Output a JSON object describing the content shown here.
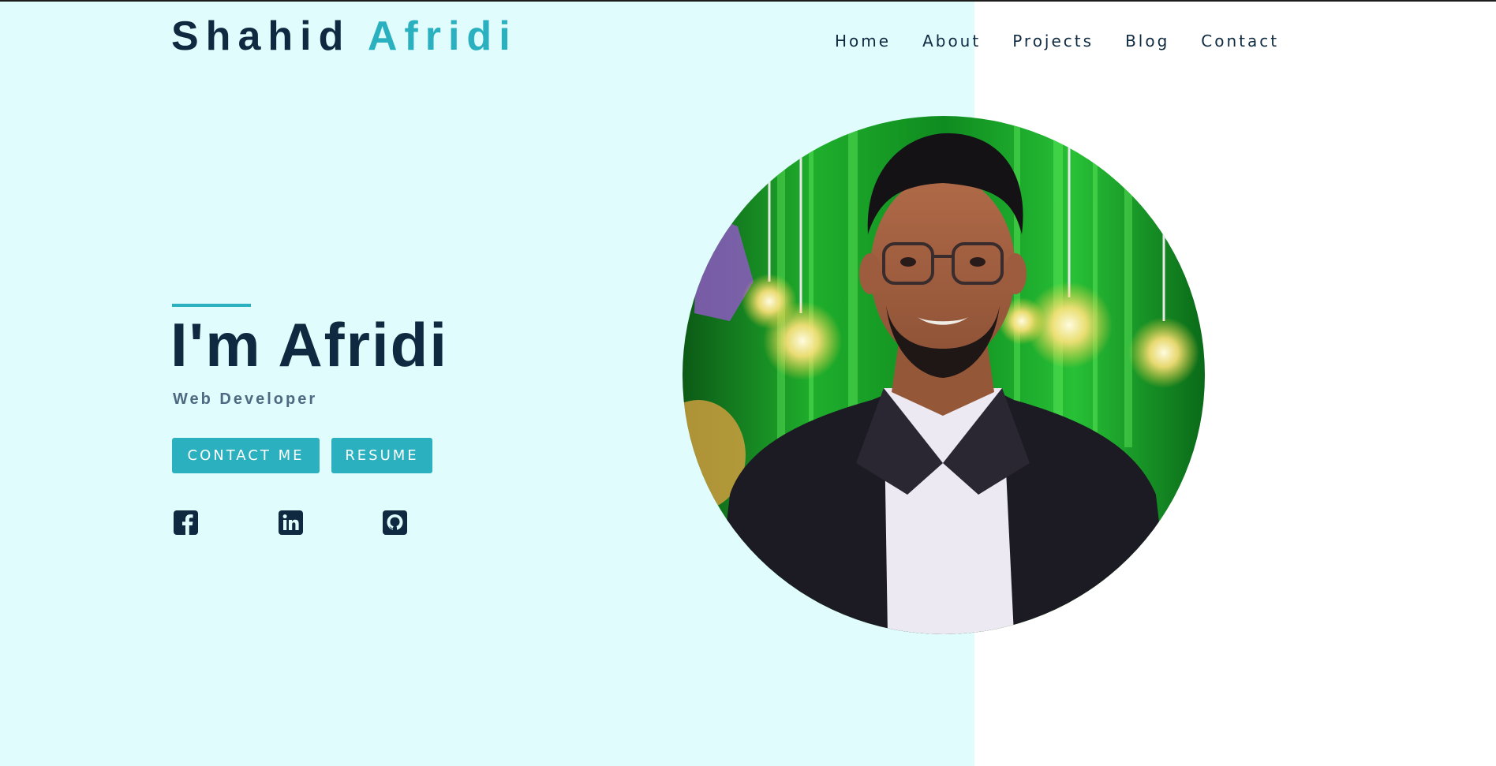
{
  "header": {
    "logo_first": "Shahid",
    "logo_second": "Afridi",
    "nav": [
      {
        "label": "Home"
      },
      {
        "label": "About"
      },
      {
        "label": "Projects"
      },
      {
        "label": "Blog"
      },
      {
        "label": "Contact"
      }
    ]
  },
  "hero": {
    "title": "I'm Afridi",
    "subtitle": "Web Developer",
    "buttons": {
      "contact": "CONTACT ME",
      "resume": "RESUME"
    },
    "social_icons": [
      "facebook-icon",
      "linkedin-icon",
      "github-icon"
    ]
  },
  "profile_photo": {
    "icon": "profile-photo"
  },
  "colors": {
    "navy": "#0f2a40",
    "accent": "#2ab0be",
    "left_background": "#e0fcfd",
    "subtitle": "#4e6a82"
  }
}
